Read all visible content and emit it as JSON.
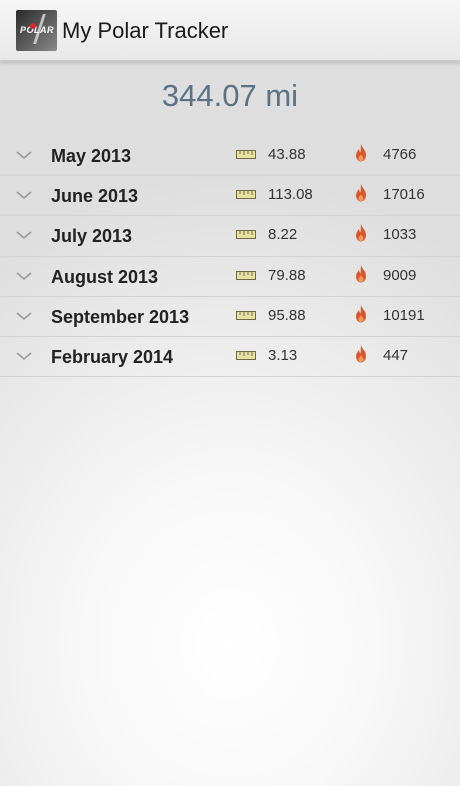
{
  "app": {
    "title": "My Polar Tracker",
    "icon_text": "POLAR"
  },
  "summary": {
    "total_distance": "344.07 mi"
  },
  "months": [
    {
      "label": "May 2013",
      "distance": "43.88",
      "calories": "4766"
    },
    {
      "label": "June 2013",
      "distance": "113.08",
      "calories": "17016"
    },
    {
      "label": "July 2013",
      "distance": "8.22",
      "calories": "1033"
    },
    {
      "label": "August 2013",
      "distance": "79.88",
      "calories": "9009"
    },
    {
      "label": "September 2013",
      "distance": "95.88",
      "calories": "10191"
    },
    {
      "label": "February 2014",
      "distance": "3.13",
      "calories": "447"
    }
  ],
  "icons": {
    "expand": "chevron-down-icon",
    "distance": "ruler-icon",
    "calories": "flame-icon"
  },
  "colors": {
    "total_text": "#5b7184",
    "flame": "#d9582b",
    "ruler": "#e8e0a0"
  }
}
